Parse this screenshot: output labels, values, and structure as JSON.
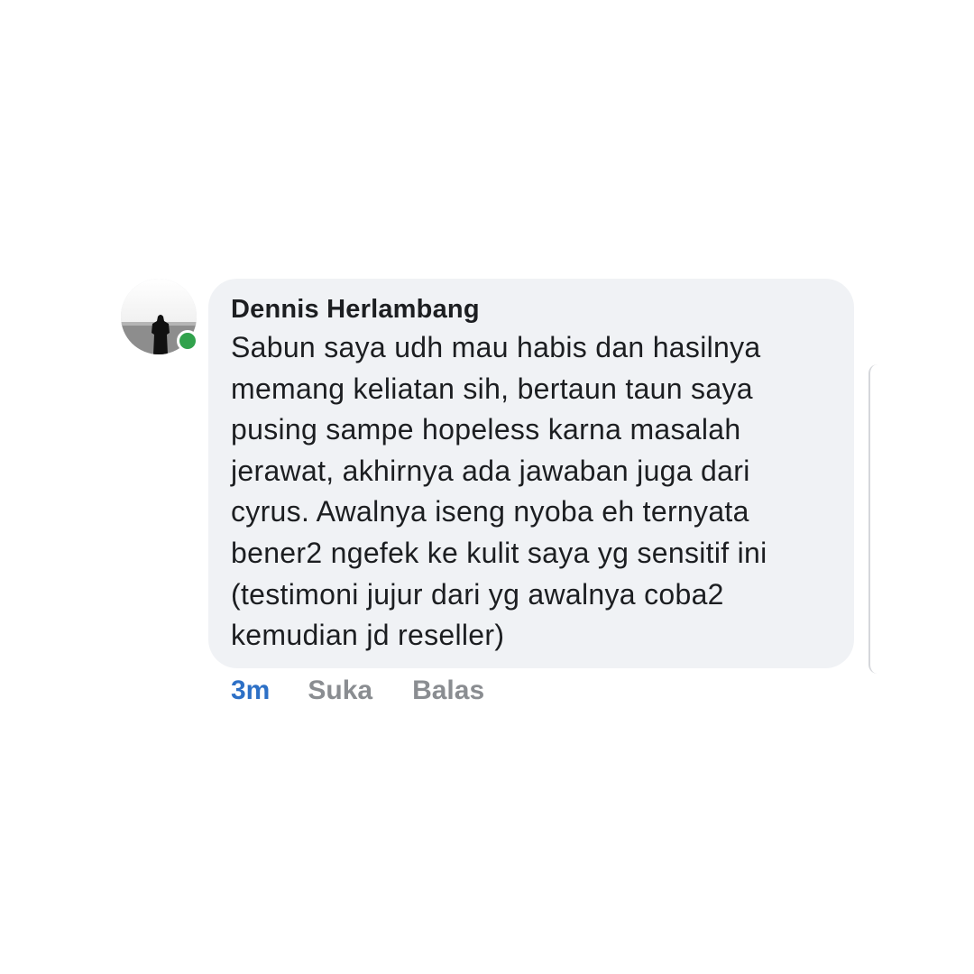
{
  "comment": {
    "author": "Dennis Herlambang",
    "lines": [
      "Sabun saya udh mau habis dan hasilnya",
      "memang keliatan sih, bertaun taun saya",
      "pusing sampe hopeless karna masalah",
      "jerawat, akhirnya ada jawaban juga dari",
      "cyrus. Awalnya iseng nyoba eh ternyata",
      "bener2 ngefek ke kulit saya yg sensitif ini",
      "(testimoni jujur dari yg awalnya coba2",
      "kemudian jd reseller)"
    ],
    "avatar_icon": "profile-photo",
    "online_status": "online"
  },
  "actions": {
    "time": "3m",
    "like": "Suka",
    "reply": "Balas"
  },
  "colors": {
    "bubble": "#f0f2f5",
    "time": "#2d70c6",
    "action": "#8a8d91",
    "online": "#31a24c"
  }
}
